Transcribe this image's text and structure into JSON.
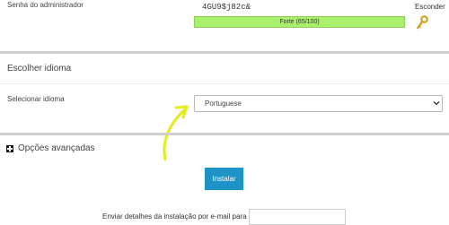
{
  "admin_password": {
    "label": "Senha do administrador",
    "value": "4GU9$j82c&",
    "strength_text": "Forte (65/100)",
    "strength_percent": 65,
    "strength_color": "#a9f06d",
    "hide_label": "Esconder",
    "key_icon": "key-icon"
  },
  "language": {
    "section_title": "Escolher idioma",
    "label": "Selecionar idioma",
    "selected": "Portuguese"
  },
  "advanced": {
    "label": "Opções avançadas",
    "icon": "plus-square-icon"
  },
  "install": {
    "button_label": "Instalar",
    "button_color": "#1e93c8",
    "email_label": "Enviar detalhes da instalação por e-mail para :",
    "email_value": ""
  },
  "annotation": {
    "arrow_color": "#e4ec1c"
  }
}
